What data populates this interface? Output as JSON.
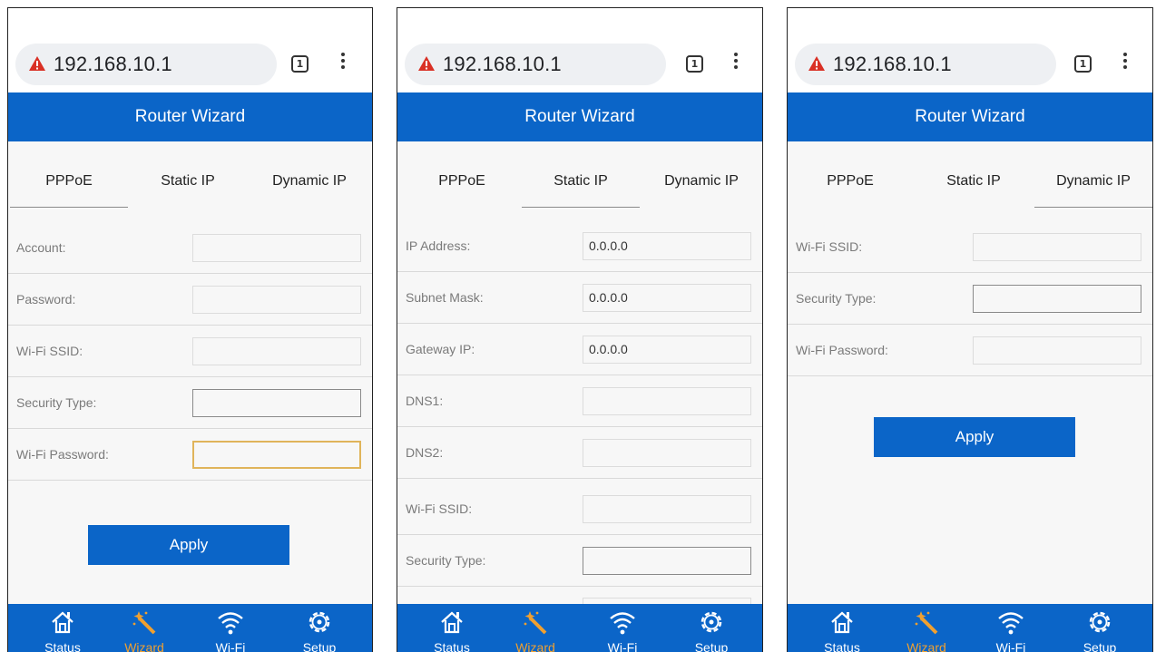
{
  "browser": {
    "url": "192.168.10.1",
    "tab_count": "1"
  },
  "header": {
    "title": "Router Wizard"
  },
  "tabs": [
    "PPPoE",
    "Static IP",
    "Dynamic IP"
  ],
  "nav": [
    {
      "label": "Status",
      "icon": "home-icon"
    },
    {
      "label": "Wizard",
      "icon": "magic-wand-icon"
    },
    {
      "label": "Wi-Fi",
      "icon": "wifi-icon"
    },
    {
      "label": "Setup",
      "icon": "gear-icon"
    }
  ],
  "colors": {
    "primary": "#0b65c8",
    "nav_active": "#f0a030",
    "warning": "#d93025",
    "focus_border": "#e0b45a"
  },
  "screens": [
    {
      "active_tab": "PPPoE",
      "fields": [
        {
          "label": "Account:",
          "value": ""
        },
        {
          "label": "Password:",
          "value": ""
        },
        {
          "label": "Wi-Fi SSID:",
          "value": ""
        },
        {
          "label": "Security Type:",
          "value": ""
        },
        {
          "label": "Wi-Fi Password:",
          "value": ""
        }
      ],
      "apply_label": "Apply"
    },
    {
      "active_tab": "Static IP",
      "fields": [
        {
          "label": "IP Address:",
          "value": "0.0.0.0"
        },
        {
          "label": "Subnet Mask:",
          "value": "0.0.0.0"
        },
        {
          "label": "Gateway IP:",
          "value": "0.0.0.0"
        },
        {
          "label": "DNS1:",
          "value": ""
        },
        {
          "label": "DNS2:",
          "value": ""
        },
        {
          "label": "Wi-Fi SSID:",
          "value": ""
        },
        {
          "label": "Security Type:",
          "value": ""
        }
      ]
    },
    {
      "active_tab": "Dynamic IP",
      "fields": [
        {
          "label": "Wi-Fi SSID:",
          "value": ""
        },
        {
          "label": "Security Type:",
          "value": ""
        },
        {
          "label": "Wi-Fi Password:",
          "value": ""
        }
      ],
      "apply_label": "Apply"
    }
  ]
}
